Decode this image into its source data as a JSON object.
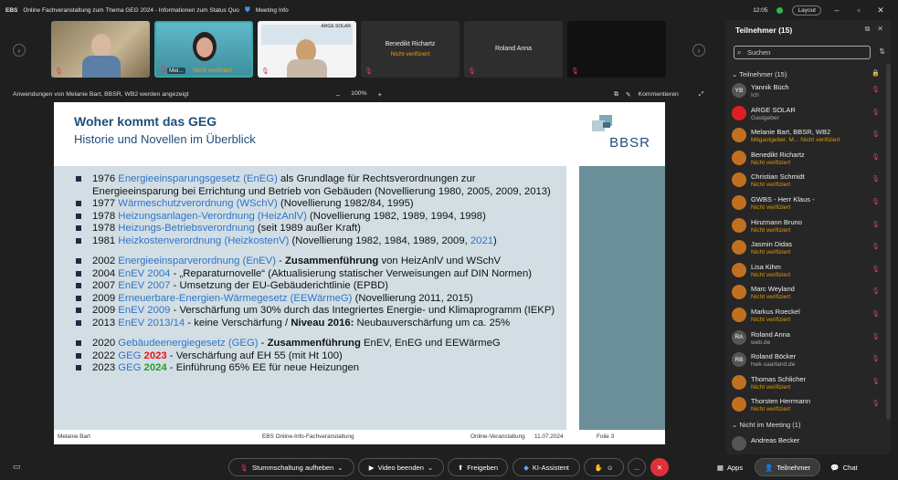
{
  "titlebar": {
    "app": "EBS",
    "title": "Online Fachveranstaltung zum Thema GEG 2024 - Informationen zum Status Quo",
    "meeting_info": "Meeting Info",
    "time": "12:05",
    "layout": "Layout"
  },
  "tiles": [
    {
      "name": "",
      "sub": ""
    },
    {
      "name": "Mel...",
      "sub": "Nicht verifiziert"
    },
    {
      "name": "",
      "sub": ""
    },
    {
      "name": "Benedikt Richartz",
      "sub": "Nicht verifiziert"
    },
    {
      "name": "Roland Anna",
      "sub": ""
    },
    {
      "name": "",
      "sub": ""
    }
  ],
  "tile3_poster": "ARGE SOLAR",
  "share": {
    "text": "Anwendungen von Melanie Bart, BBSR, WB2 werden angezeigt",
    "zoom": "100%",
    "comments": "Kommentieren"
  },
  "slide": {
    "title": "Woher kommt das GEG",
    "subtitle": "Historie und Novellen im Überblick",
    "logo": "BBSR",
    "lines": [
      {
        "a": "1976 ",
        "b": "Energieeinsparungsgesetz (EnEG)",
        "c": " als Grundlage für Rechtsverordnungen zur"
      },
      {
        "a": "Energieeinsparung bei Errichtung und Betrieb von Gebäuden (Novellierung 1980, 2005, 2009, 2013)",
        "b": "",
        "c": ""
      },
      {
        "a": "1977 ",
        "b": "Wärmeschutzverordnung (WSchV)",
        "c": " (Novellierung 1982/84, 1995)"
      },
      {
        "a": "1978 ",
        "b": "Heizungsanlagen-Verordnung (HeizAnlV)",
        "c": " (Novellierung 1982, 1989, 1994, 1998)"
      },
      {
        "a": "1978 ",
        "b": "Heizungs-Betriebsverordnung",
        "c": " (seit 1989 außer Kraft)"
      },
      {
        "a": "1981 ",
        "b": "Heizkostenverordnung (HeizkostenV)",
        "c": " (Novellierung 1982, 1984, 1989, 2009, ",
        "d": "2021",
        "e": ")"
      },
      {
        "a": "2002 ",
        "b": "Energieeinsparverordnung (EnEV)",
        "c": " - ",
        "d": "Zusammenführung",
        "e": " von HeizAnlV und WSchV"
      },
      {
        "a": "2004 ",
        "b": "EnEV 2004",
        "c": " - „Reparaturnovelle“ (Aktualisierung statischer Verweisungen auf DIN Normen)"
      },
      {
        "a": "2007 ",
        "b": "EnEV 2007",
        "c": " - Umsetzung der EU-Gebäuderichtlinie (EPBD)"
      },
      {
        "a": "2009 ",
        "b": "Erneuerbare-Energien-Wärmegesetz (EEWärmeG)",
        "c": " (Novellierung 2011, 2015)"
      },
      {
        "a": "2009 ",
        "b": "EnEV 2009",
        "c": " - Verschärfung um 30% durch das Integriertes Energie- und Klimaprogramm (IEKP)"
      },
      {
        "a": "2013 ",
        "b": "EnEV 2013/14",
        "c": " - keine Verschärfung / ",
        "d": "Niveau 2016:",
        "e": " Neubauverschärfung um ca. 25%"
      },
      {
        "a": "2020 ",
        "b": "Gebäudeenergiegesetz (GEG)",
        "c": " - ",
        "d": "Zusammenführung",
        "e": " EnEV, EnEG und EEWärmeG"
      },
      {
        "a": "2022 ",
        "b": "GEG ",
        "d": "2023",
        "c": " - Verschärfung auf EH 55 (mit Ht 100)"
      },
      {
        "a": "2023 ",
        "b": "GEG ",
        "d": "2024",
        "c": " - Einführung 65% EE für neue Heizungen"
      }
    ],
    "footer": {
      "presenter": "Melanie Bart",
      "center": "EBS Online-Info-Fachveranstaltung",
      "event": "Online-Veranstaltung",
      "date": "11.07.2024",
      "page": "Folie 3"
    }
  },
  "controls": {
    "mute": "Stummschaltung aufheben",
    "video": "Video beenden",
    "share": "Freigeben",
    "ai": "KI-Assistent",
    "more": "...",
    "apps": "Apps",
    "participants": "Teilnehmer",
    "chat": "Chat"
  },
  "panel": {
    "title": "Teilnehmer (15)",
    "search_placeholder": "Suchen",
    "section_in": "Teilnehmer (15)",
    "section_out": "Nicht im Meeting (1)",
    "participants": [
      {
        "initials": "YB",
        "name": "Yannik Büch",
        "sub": "Ich",
        "color": "#555555"
      },
      {
        "initials": "",
        "name": "ARGE SOLAR",
        "sub": "Gastgeber",
        "color": "#e02020"
      },
      {
        "initials": "",
        "name": "Melanie Bart, BBSR, WB2",
        "sub": "Mitgastgeber, M...  Nicht verifiziert",
        "color": "#c07020"
      },
      {
        "initials": "",
        "name": "Benedikt Richartz",
        "sub": "Nicht verifiziert",
        "color": "#c07020"
      },
      {
        "initials": "",
        "name": "Christian Schmidt",
        "sub": "Nicht verifiziert",
        "color": "#c07020"
      },
      {
        "initials": "",
        "name": "GWBS - Herr Klaus -",
        "sub": "Nicht verifiziert",
        "color": "#c07020"
      },
      {
        "initials": "",
        "name": "Hinzmann Bruno",
        "sub": "Nicht verifiziert",
        "color": "#c07020"
      },
      {
        "initials": "",
        "name": "Jasmin Didas",
        "sub": "Nicht verifiziert",
        "color": "#c07020"
      },
      {
        "initials": "",
        "name": "Lisa Kihm",
        "sub": "Nicht verifiziert",
        "color": "#c07020"
      },
      {
        "initials": "",
        "name": "Marc Weyland",
        "sub": "Nicht verifiziert",
        "color": "#c07020"
      },
      {
        "initials": "",
        "name": "Markus Roeckel",
        "sub": "Nicht verifiziert",
        "color": "#c07020"
      },
      {
        "initials": "RA",
        "name": "Roland Anna",
        "sub": "web.de",
        "color": "#555555"
      },
      {
        "initials": "RB",
        "name": "Roland Böcker",
        "sub": "hwk-saarland.de",
        "color": "#555555"
      },
      {
        "initials": "",
        "name": "Thomas Schlicher",
        "sub": "Nicht verifiziert",
        "color": "#c07020"
      },
      {
        "initials": "",
        "name": "Thorsten Herrmann",
        "sub": "Nicht verifiziert",
        "color": "#c07020"
      }
    ],
    "out": [
      {
        "initials": "",
        "name": "Andreas Becker",
        "color": "#555555"
      }
    ]
  }
}
